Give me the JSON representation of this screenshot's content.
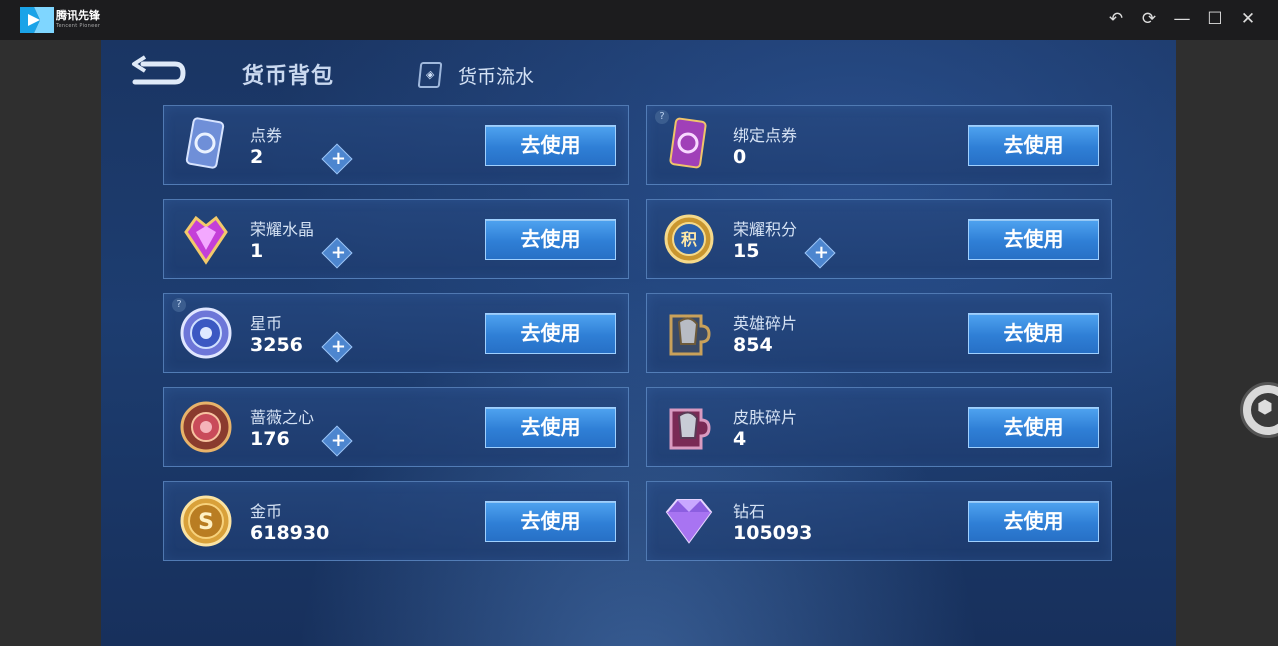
{
  "titlebar": {
    "app_name": "腾讯先锋",
    "app_subtitle": "Tencent Pioneer",
    "controls": [
      "undo-icon",
      "refresh-icon",
      "minimize-icon",
      "maximize-icon",
      "close-icon"
    ]
  },
  "header": {
    "active_tab": "货币背包",
    "other_tab": "货币流水"
  },
  "currencies": [
    {
      "name": "点券",
      "value": "2",
      "has_plus": true,
      "has_help": false,
      "icon": "voucher-card-icon",
      "button": "去使用"
    },
    {
      "name": "绑定点券",
      "value": "0",
      "has_plus": false,
      "has_help": true,
      "icon": "bound-voucher-card-icon",
      "button": "去使用"
    },
    {
      "name": "荣耀水晶",
      "value": "1",
      "has_plus": true,
      "has_help": false,
      "icon": "glory-crystal-icon",
      "button": "去使用"
    },
    {
      "name": "荣耀积分",
      "value": "15",
      "has_plus": true,
      "has_help": false,
      "icon": "glory-points-icon",
      "button": "去使用"
    },
    {
      "name": "星币",
      "value": "3256",
      "has_plus": true,
      "has_help": true,
      "icon": "star-coin-icon",
      "button": "去使用"
    },
    {
      "name": "英雄碎片",
      "value": "854",
      "has_plus": false,
      "has_help": false,
      "icon": "hero-fragment-icon",
      "button": "去使用"
    },
    {
      "name": "蔷薇之心",
      "value": "176",
      "has_plus": true,
      "has_help": false,
      "icon": "rose-heart-icon",
      "button": "去使用"
    },
    {
      "name": "皮肤碎片",
      "value": "4",
      "has_plus": false,
      "has_help": false,
      "icon": "skin-fragment-icon",
      "button": "去使用"
    },
    {
      "name": "金币",
      "value": "618930",
      "has_plus": false,
      "has_help": false,
      "icon": "gold-coin-icon",
      "button": "去使用"
    },
    {
      "name": "钻石",
      "value": "105093",
      "has_plus": false,
      "has_help": false,
      "icon": "diamond-icon",
      "button": "去使用"
    }
  ],
  "colors": {
    "accent_button": "#3a8ee2",
    "panel_bg": "#1d3d70",
    "text_primary": "#ffffff",
    "text_secondary": "#d5e2f4"
  }
}
